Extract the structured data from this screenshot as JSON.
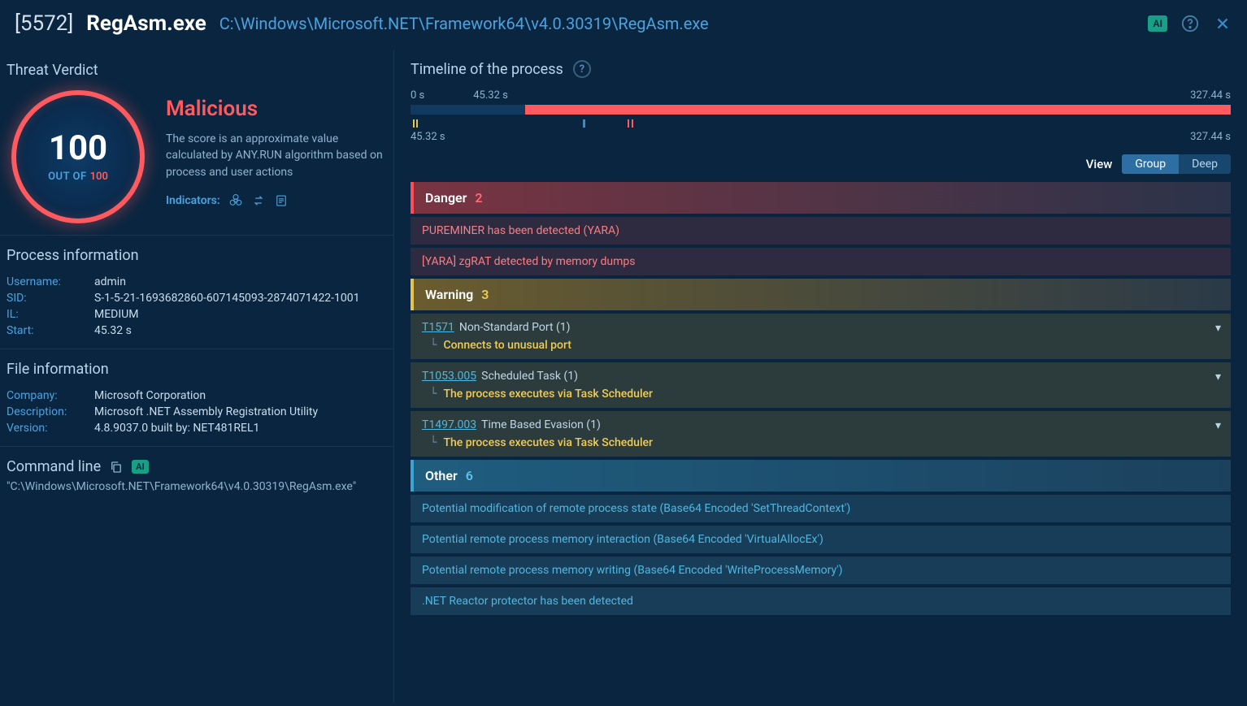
{
  "header": {
    "pid": "[5572]",
    "pname": "RegAsm.exe",
    "path": "C:\\Windows\\Microsoft.NET\\Framework64\\v4.0.30319\\RegAsm.exe",
    "ai_badge": "AI"
  },
  "verdict": {
    "section_title": "Threat Verdict",
    "score": "100",
    "out_of_label": "OUT OF",
    "max_score": "100",
    "name": "Malicious",
    "description": "The score is an approximate value calculated by ANY.RUN algorithm based on process and user actions",
    "indicators_label": "Indicators:"
  },
  "process_info": {
    "title": "Process information",
    "rows": [
      {
        "label": "Username:",
        "value": "admin"
      },
      {
        "label": "SID:",
        "value": "S-1-5-21-1693682860-607145093-2874071422-1001"
      },
      {
        "label": "IL:",
        "value": "MEDIUM"
      },
      {
        "label": "Start:",
        "value": "45.32 s"
      }
    ]
  },
  "file_info": {
    "title": "File information",
    "rows": [
      {
        "label": "Company:",
        "value": "Microsoft Corporation"
      },
      {
        "label": "Description:",
        "value": "Microsoft .NET Assembly Registration Utility"
      },
      {
        "label": "Version:",
        "value": "4.8.9037.0 built by: NET481REL1"
      }
    ]
  },
  "cmdline": {
    "title": "Command line",
    "ai_badge": "AI",
    "text": "\"C:\\Windows\\Microsoft.NET\\Framework64\\v4.0.30319\\RegAsm.exe\""
  },
  "timeline": {
    "title": "Timeline of the process",
    "labels_top": {
      "start": "0 s",
      "mid": "45.32 s",
      "end": "327.44 s"
    },
    "labels_bot": {
      "start": "45.32 s",
      "end": "327.44 s"
    },
    "view_label": "View",
    "tabs": {
      "group": "Group",
      "deep": "Deep"
    }
  },
  "categories": {
    "danger": {
      "label": "Danger",
      "count": "2",
      "items": [
        "PUREMINER has been detected (YARA)",
        "[YARA] zgRAT detected by memory dumps"
      ]
    },
    "warning": {
      "label": "Warning",
      "count": "3",
      "items": [
        {
          "tcode": "T1571",
          "tdesc": "Non-Standard Port (1)",
          "sub": "Connects to unusual port"
        },
        {
          "tcode": "T1053.005",
          "tdesc": "Scheduled Task (1)",
          "sub": "The process executes via Task Scheduler"
        },
        {
          "tcode": "T1497.003",
          "tdesc": "Time Based Evasion (1)",
          "sub": "The process executes via Task Scheduler"
        }
      ]
    },
    "other": {
      "label": "Other",
      "count": "6",
      "items": [
        "Potential modification of remote process state (Base64 Encoded 'SetThreadContext')",
        "Potential remote process memory interaction (Base64 Encoded 'VirtualAllocEx')",
        "Potential remote process memory writing (Base64 Encoded 'WriteProcessMemory')",
        ".NET Reactor protector has been detected"
      ]
    }
  }
}
